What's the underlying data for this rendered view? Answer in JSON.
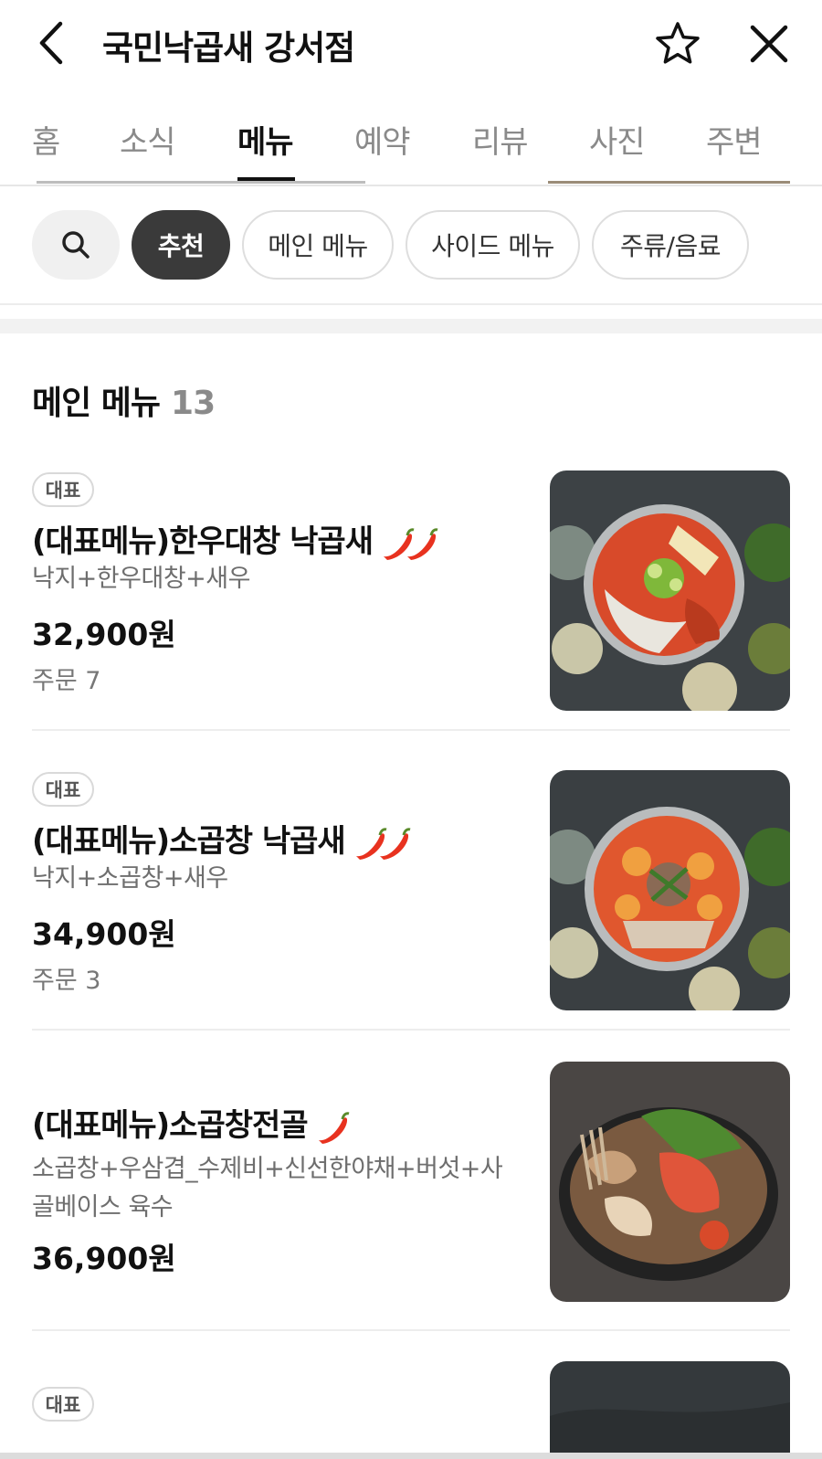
{
  "header": {
    "title": "국민낙곱새 강서점"
  },
  "tabs": [
    {
      "label": "홈"
    },
    {
      "label": "소식"
    },
    {
      "label": "메뉴",
      "active": true
    },
    {
      "label": "예약"
    },
    {
      "label": "리뷰"
    },
    {
      "label": "사진"
    },
    {
      "label": "주변"
    }
  ],
  "filters": [
    {
      "label": "추천",
      "active": true
    },
    {
      "label": "메인 메뉴"
    },
    {
      "label": "사이드 메뉴"
    },
    {
      "label": "주류/음료"
    }
  ],
  "section": {
    "title": "메인 메뉴",
    "count": "13"
  },
  "items": [
    {
      "badge": "대표",
      "name": "(대표메뉴)한우대창 낙곱새",
      "spice_level": 2,
      "description": "낙지+한우대창+새우",
      "price": "32,900원",
      "orders": "주문 7"
    },
    {
      "badge": "대표",
      "name": "(대표메뉴)소곱창 낙곱새",
      "spice_level": 2,
      "description": "낙지+소곱창+새우",
      "price": "34,900원",
      "orders": "주문 3"
    },
    {
      "name": "(대표메뉴)소곱창전골",
      "spice_level": 1,
      "description": "소곱창+우삼겹_수제비+신선한야채+버섯+사골베이스 육수",
      "price": "36,900원"
    },
    {
      "badge": "대표"
    }
  ],
  "colors": {
    "accent": "#111111",
    "chip_active_bg": "#3a3a3a",
    "muted_text": "#8a8a8a",
    "pepper_red": "#e8321f"
  },
  "icons": {
    "back": "chevron-left-icon",
    "favorite": "star-icon",
    "close": "close-icon",
    "search": "search-icon",
    "spicy": "chili-pepper-icon"
  }
}
